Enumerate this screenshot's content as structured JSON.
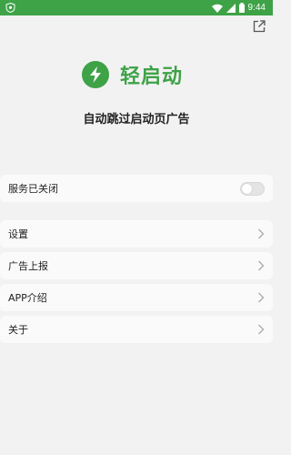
{
  "status_bar": {
    "time": "9:44",
    "icons": [
      "shield-icon",
      "wifi-icon",
      "signal-icon",
      "battery-icon"
    ]
  },
  "header": {
    "share_icon": "external-link-icon"
  },
  "app": {
    "name": "轻启动",
    "tagline": "自动跳过启动页广告",
    "logo_icon": "lightning-icon",
    "accent_color": "#3ea247"
  },
  "service_card": {
    "label": "服务已关闭",
    "toggle_on": false
  },
  "menu": {
    "items": [
      {
        "label": "设置"
      },
      {
        "label": "广告上报"
      },
      {
        "label": "APP介绍"
      },
      {
        "label": "关于"
      }
    ]
  }
}
